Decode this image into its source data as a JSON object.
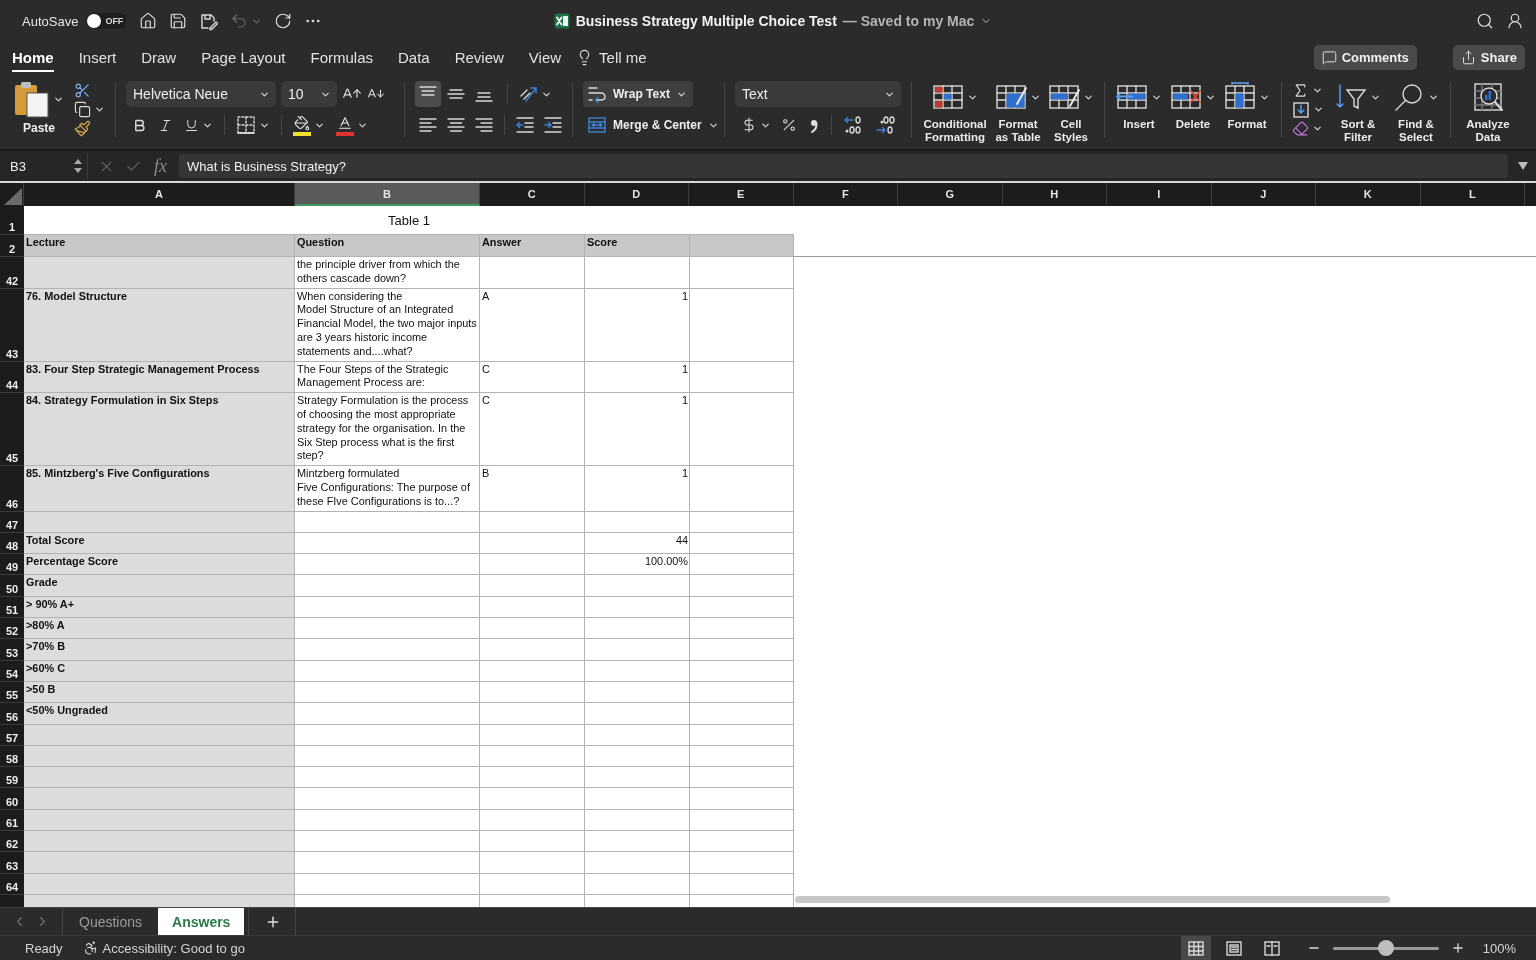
{
  "title_bar": {
    "autosave": {
      "label": "AutoSave",
      "on": false,
      "state_label": "OFF"
    },
    "undo": {
      "disabled": true
    },
    "document_title": "Business Strategy Multiple Choice Test",
    "save_status": "— Saved to my Mac"
  },
  "menu": {
    "tabs": [
      {
        "label": "Home",
        "selected": true
      },
      {
        "label": "Insert",
        "selected": false
      },
      {
        "label": "Draw",
        "selected": false
      },
      {
        "label": "Page Layout",
        "selected": false
      },
      {
        "label": "Formulas",
        "selected": false
      },
      {
        "label": "Data",
        "selected": false
      },
      {
        "label": "Review",
        "selected": false
      },
      {
        "label": "View",
        "selected": false
      }
    ],
    "tell_me": "Tell me",
    "comments": "Comments",
    "share": "Share"
  },
  "ribbon": {
    "paste": "Paste",
    "font_name": "Helvetica Neue",
    "font_size": "10",
    "vertical_align": [
      {
        "kind": "top",
        "selected": true
      },
      {
        "kind": "middle",
        "selected": false
      },
      {
        "kind": "bottom",
        "selected": false
      }
    ],
    "wrap_text": {
      "label": "Wrap Text",
      "on": true
    },
    "merge_center": "Merge & Center",
    "number_format": "Text",
    "style_buttons": [
      {
        "kind": "conditional_formatting",
        "label": "Conditional Formatting"
      },
      {
        "kind": "format_as_table",
        "label": "Format as Table"
      },
      {
        "kind": "cell_styles",
        "label": "Cell Styles"
      }
    ],
    "cell_buttons": [
      {
        "kind": "insert",
        "label": "Insert"
      },
      {
        "kind": "delete",
        "label": "Delete"
      },
      {
        "kind": "format",
        "label": "Format"
      }
    ],
    "editing_buttons": [
      {
        "kind": "sort_filter",
        "label": "Sort & Filter"
      },
      {
        "kind": "find_select",
        "label": "Find & Select"
      }
    ],
    "analysis_buttons": [
      {
        "kind": "analyze_data",
        "label": "Analyze Data"
      }
    ]
  },
  "formula_bar": {
    "name_box": "B3",
    "function_label": "fx",
    "formula": "What is Business Strategy?"
  },
  "column_headers": [
    {
      "label": "A",
      "selected": false
    },
    {
      "label": "B",
      "selected": true
    },
    {
      "label": "C",
      "selected": false
    },
    {
      "label": "D",
      "selected": false
    },
    {
      "label": "E",
      "selected": false
    },
    {
      "label": "F",
      "selected": false
    },
    {
      "label": "G",
      "selected": false
    },
    {
      "label": "H",
      "selected": false
    },
    {
      "label": "I",
      "selected": false
    },
    {
      "label": "J",
      "selected": false
    },
    {
      "label": "K",
      "selected": false
    },
    {
      "label": "L",
      "selected": false
    }
  ],
  "sheet": {
    "title_row": {
      "number": "1",
      "title": "Table 1"
    },
    "header_row": {
      "number": "2",
      "columns": [
        "Lecture",
        "Question",
        "Answer",
        "Score"
      ]
    },
    "rows": [
      {
        "number": "42",
        "question": "the principle driver from which the others cascade down?"
      },
      {
        "number": "43",
        "lecture": "76. Model Structure",
        "question": "When considering the\nModel Structure of an Integrated Financial Model, the two major inputs are 3 years historic income statements and....what?",
        "answer": "A",
        "score": "1"
      },
      {
        "number": "44",
        "lecture": "83. Four Step Strategic Management Process",
        "question": "The Four Steps of the Strategic Management Process are:",
        "answer": "C",
        "score": "1"
      },
      {
        "number": "45",
        "lecture": "84. Strategy Formulation in Six Steps",
        "question": "Strategy Formulation is the process of choosing the most appropriate strategy for the organisation. In the Six Step process what is the first step?",
        "answer": "C",
        "score": "1"
      },
      {
        "number": "46",
        "lecture": "85. Mintzberg's Five Configurations",
        "question": "Mintzberg formulated\nFive Configurations: The purpose of these FIve Configurations is to...?",
        "answer": "B",
        "score": "1"
      },
      {
        "number": "47"
      },
      {
        "number": "48",
        "lecture": "Total Score",
        "score": "44"
      },
      {
        "number": "49",
        "lecture": "Percentage Score",
        "score": "100.00%"
      },
      {
        "number": "50",
        "lecture": "Grade"
      },
      {
        "number": "51",
        "lecture": "> 90% A+"
      },
      {
        "number": "52",
        "lecture": ">80% A"
      },
      {
        "number": "53",
        "lecture": ">70% B"
      },
      {
        "number": "54",
        "lecture": ">60% C"
      },
      {
        "number": "55",
        "lecture": ">50 B"
      },
      {
        "number": "56",
        "lecture": "<50% Ungraded"
      },
      {
        "number": "57"
      },
      {
        "number": "58"
      },
      {
        "number": "59"
      },
      {
        "number": "60"
      },
      {
        "number": "61"
      },
      {
        "number": "62"
      },
      {
        "number": "63"
      },
      {
        "number": "64"
      }
    ]
  },
  "sheet_tabs": [
    {
      "label": "Questions",
      "selected": false
    },
    {
      "label": "Answers",
      "selected": true
    }
  ],
  "status_bar": {
    "status": "Ready",
    "accessibility": "Accessibility: Good to go",
    "views": [
      {
        "kind": "normal",
        "selected": true
      },
      {
        "kind": "page_layout",
        "selected": false
      },
      {
        "kind": "page_break",
        "selected": false
      }
    ],
    "zoom": {
      "level": 0.5,
      "label": "100%"
    }
  }
}
